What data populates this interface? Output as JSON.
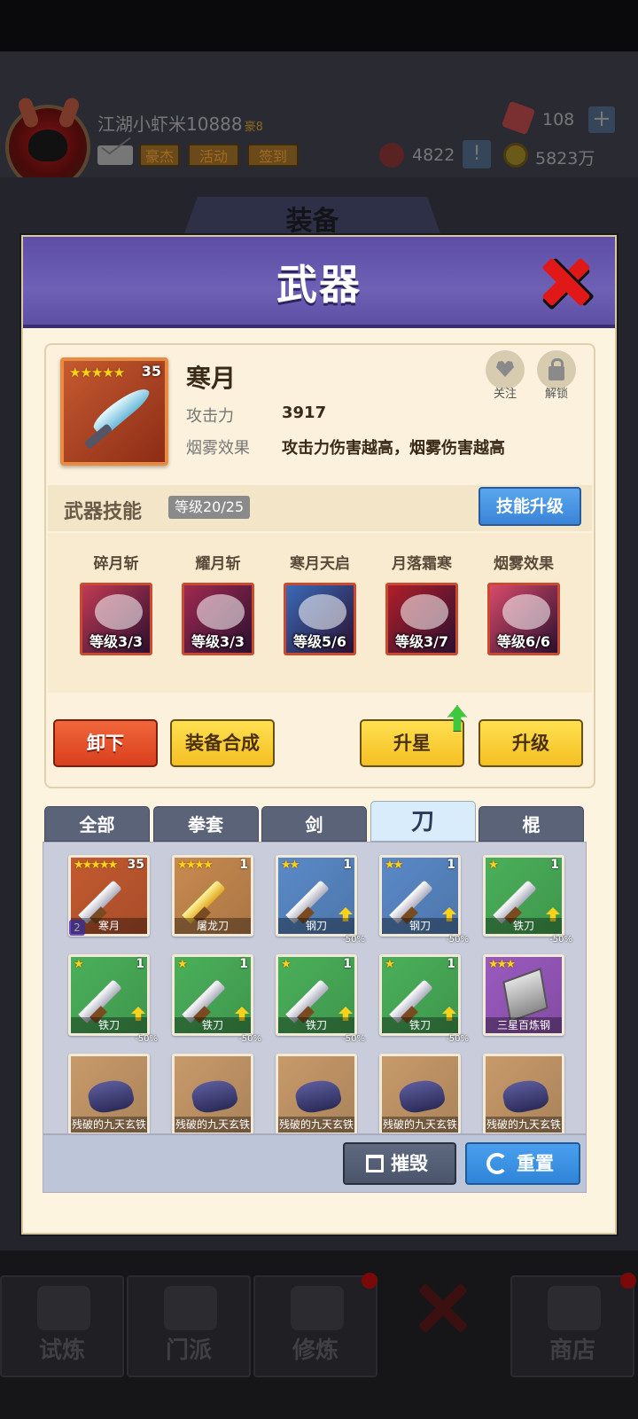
{
  "header": {
    "player_name": "江湖小虾米10888",
    "player_rank": "豪8",
    "tags": [
      "豪杰",
      "活动",
      "签到"
    ],
    "gems": "108",
    "energy": "4822",
    "coins": "5823万",
    "background_title": "装备"
  },
  "dialog": {
    "title": "武器",
    "weapon": {
      "name": "寒月",
      "stars": "★★★★★",
      "level": "35",
      "attack_label": "攻击力",
      "attack_value": "3917",
      "effect_label": "烟雾效果",
      "effect_value": "攻击力伤害越高，烟雾伤害越高",
      "follow_label": "关注",
      "unlock_label": "解锁"
    },
    "skills_section": {
      "title": "武器技能",
      "level_tag": "等级20/25",
      "upgrade_button": "技能升级",
      "skills": [
        {
          "name": "碎月斩",
          "level": "等级3/3",
          "color": "#c23a55"
        },
        {
          "name": "耀月斩",
          "level": "等级3/3",
          "color": "#a02a50"
        },
        {
          "name": "寒月天启",
          "level": "等级5/6",
          "color": "#3a6ab8"
        },
        {
          "name": "月落霜寒",
          "level": "等级3/7",
          "color": "#b01f2a"
        },
        {
          "name": "烟雾效果",
          "level": "等级6/6",
          "color": "#d84a6a"
        }
      ]
    },
    "actions": {
      "unequip": "卸下",
      "synthesize": "装备合成",
      "star_up": "升星",
      "upgrade": "升级"
    },
    "tabs": [
      "全部",
      "拳套",
      "剑",
      "刀",
      "棍"
    ],
    "active_tab": "刀",
    "inventory": [
      {
        "name": "寒月",
        "stars": "★★★★★",
        "count": "35",
        "color": "#c45a30",
        "badge": "2"
      },
      {
        "name": "屠龙刀",
        "stars": "★★★★",
        "count": "1",
        "color": "#c88a50"
      },
      {
        "name": "钢刀",
        "stars": "★★",
        "count": "1",
        "color": "#5a8ac8",
        "pct": "-50%"
      },
      {
        "name": "钢刀",
        "stars": "★★",
        "count": "1",
        "color": "#5a8ac8",
        "pct": "-50%"
      },
      {
        "name": "铁刀",
        "stars": "★",
        "count": "1",
        "color": "#4ab05a",
        "pct": "-50%"
      },
      {
        "name": "铁刀",
        "stars": "★",
        "count": "1",
        "color": "#4ab05a",
        "pct": "-50%"
      },
      {
        "name": "铁刀",
        "stars": "★",
        "count": "1",
        "color": "#4ab05a",
        "pct": "-50%"
      },
      {
        "name": "铁刀",
        "stars": "★",
        "count": "1",
        "color": "#4ab05a",
        "pct": "-50%"
      },
      {
        "name": "铁刀",
        "stars": "★",
        "count": "1",
        "color": "#4ab05a",
        "pct": "-50%"
      },
      {
        "name": "三星百炼钢",
        "stars": "★★★",
        "count": "",
        "color": "#9a5ac0"
      },
      {
        "name": "残破的九天玄铁",
        "stars": "",
        "count": "",
        "color": "#c89a6a"
      },
      {
        "name": "残破的九天玄铁",
        "stars": "",
        "count": "",
        "color": "#c89a6a"
      },
      {
        "name": "残破的九天玄铁",
        "stars": "",
        "count": "",
        "color": "#c89a6a"
      },
      {
        "name": "残破的九天玄铁",
        "stars": "",
        "count": "",
        "color": "#c89a6a"
      },
      {
        "name": "残破的九天玄铁",
        "stars": "",
        "count": "",
        "color": "#c89a6a"
      }
    ],
    "destroy_button": "摧毁",
    "reset_button": "重置"
  },
  "bottom_nav": [
    "试炼",
    "门派",
    "修炼",
    "商店"
  ],
  "colors": {
    "title_purple": "#6e60b5",
    "panel_cream": "#fdf4e0",
    "close_red": "#e01818"
  }
}
